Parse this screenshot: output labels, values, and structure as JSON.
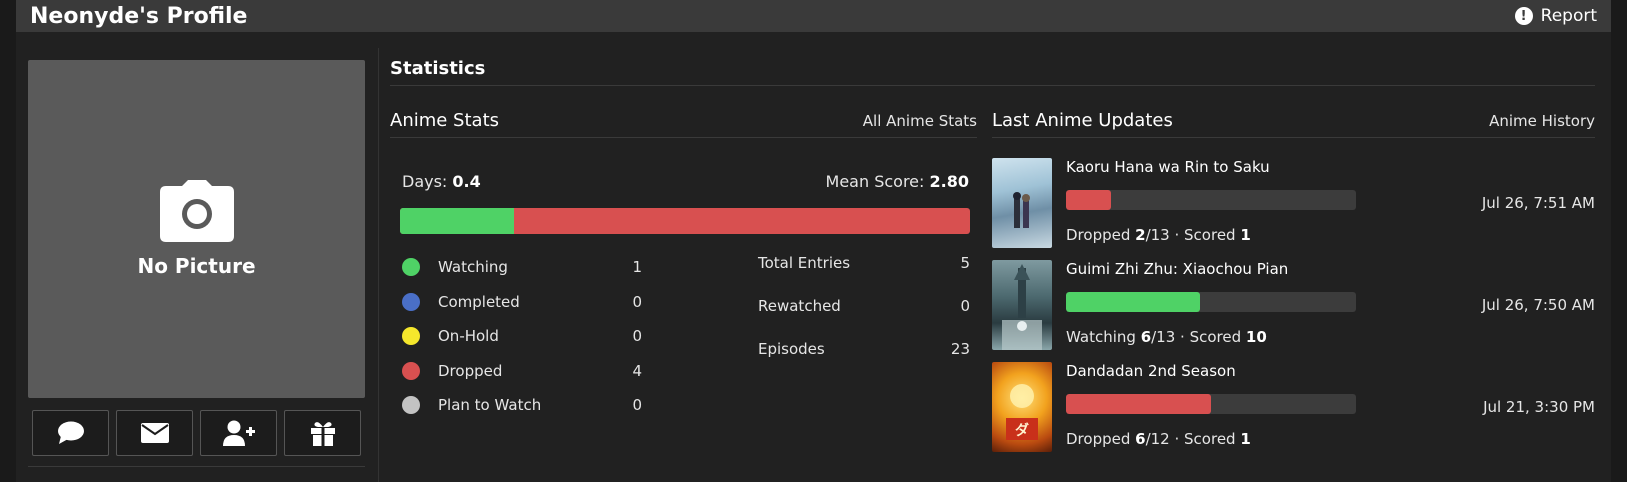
{
  "header": {
    "title": "Neonyde's Profile",
    "report_label": "Report"
  },
  "profile": {
    "no_picture_label": "No Picture",
    "actions": [
      {
        "icon": "comment-icon"
      },
      {
        "icon": "envelope-icon"
      },
      {
        "icon": "add-friend-icon"
      },
      {
        "icon": "gift-icon"
      }
    ]
  },
  "statistics": {
    "title": "Statistics",
    "anime_stats": {
      "heading": "Anime Stats",
      "link": "All Anime Stats",
      "days_label": "Days:",
      "days_value": "0.4",
      "mean_label": "Mean Score:",
      "mean_value": "2.80",
      "watching_fraction": 0.2,
      "statuses": [
        {
          "label": "Watching",
          "count": "1",
          "color": "#4fd266"
        },
        {
          "label": "Completed",
          "count": "0",
          "color": "#4a6fc7"
        },
        {
          "label": "On-Hold",
          "count": "0",
          "color": "#f5e72c"
        },
        {
          "label": "Dropped",
          "count": "4",
          "color": "#d85050"
        },
        {
          "label": "Plan to Watch",
          "count": "0",
          "color": "#c3c3c3"
        }
      ],
      "totals": [
        {
          "label": "Total Entries",
          "value": "5"
        },
        {
          "label": "Rewatched",
          "value": "0"
        },
        {
          "label": "Episodes",
          "value": "23"
        }
      ]
    },
    "updates": {
      "heading": "Last Anime Updates",
      "link": "Anime History",
      "items": [
        {
          "title": "Kaoru Hana wa Rin to Saku",
          "status": "Dropped",
          "progress": "2",
          "total": "/13",
          "scored_label": "· Scored",
          "score": "1",
          "date": "Jul 26, 7:51 AM",
          "progress_fraction": 0.1538,
          "bar_color": "#d85050"
        },
        {
          "title": "Guimi Zhi Zhu: Xiaochou Pian",
          "status": "Watching",
          "progress": "6",
          "total": "/13",
          "scored_label": "· Scored",
          "score": "10",
          "date": "Jul 26, 7:50 AM",
          "progress_fraction": 0.4615,
          "bar_color": "#4fd266"
        },
        {
          "title": "Dandadan 2nd Season",
          "status": "Dropped",
          "progress": "6",
          "total": "/12",
          "scored_label": "· Scored",
          "score": "1",
          "date": "Jul 21, 3:30 PM",
          "progress_fraction": 0.5,
          "bar_color": "#d85050"
        }
      ]
    }
  }
}
